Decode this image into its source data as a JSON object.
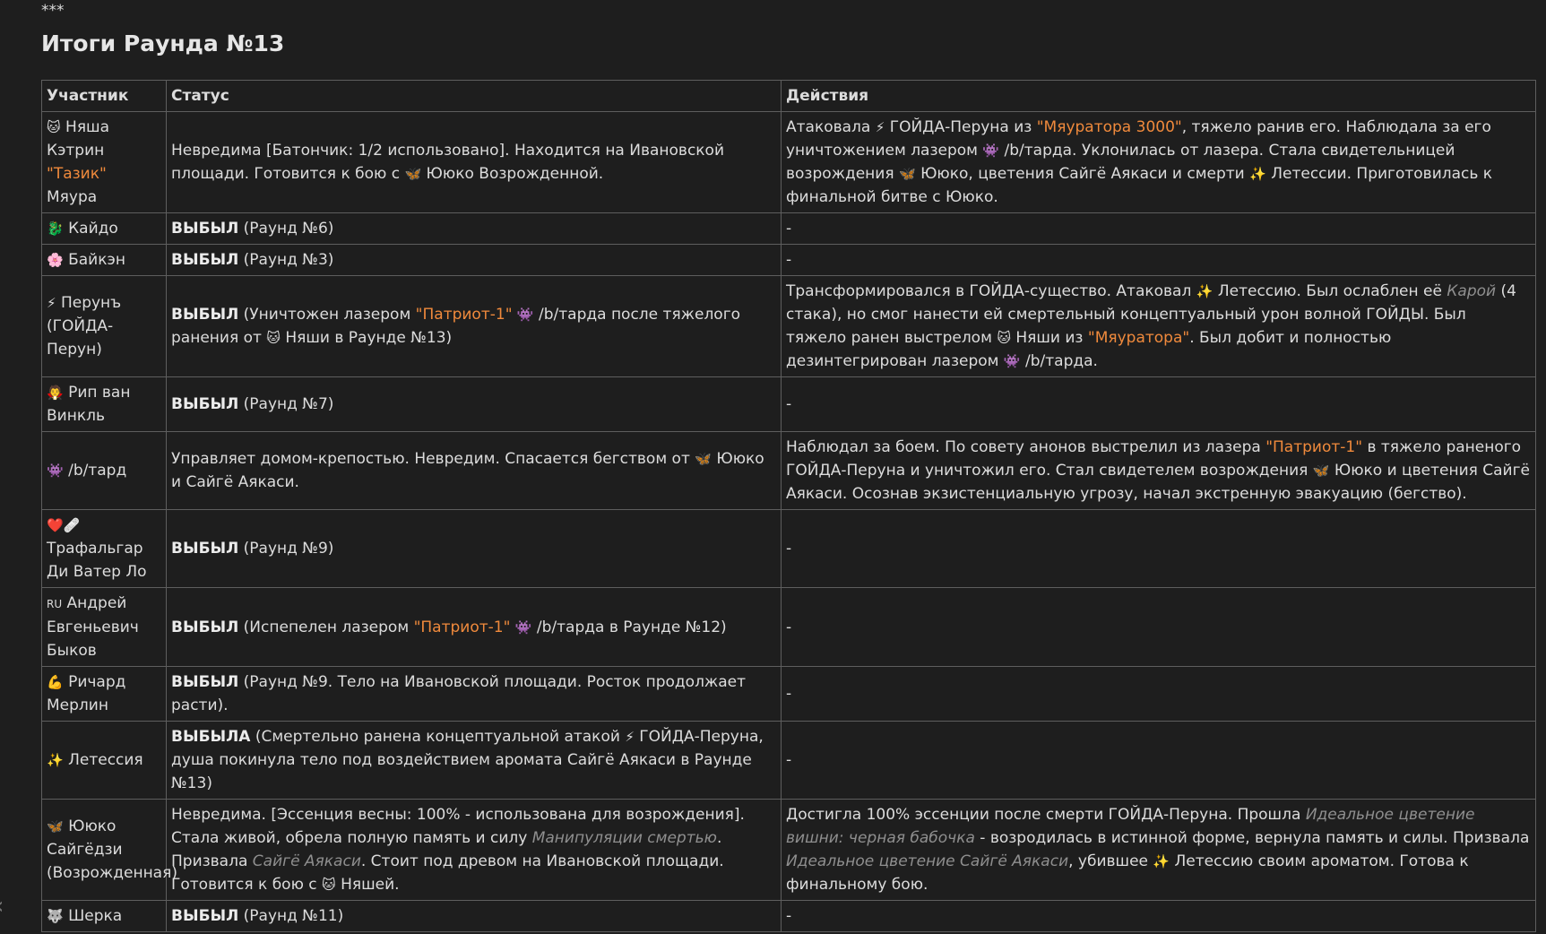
{
  "separator": "***",
  "title": "Итоги Раунда №13",
  "headers": {
    "participant": "Участник",
    "status": "Статус",
    "actions": "Действия"
  },
  "rows": [
    {
      "name": [
        "🐱",
        " Няша Кэтрин ",
        "\"Тазик\"",
        " Мяура"
      ],
      "status": [
        "Невредима [Батончик: 1/2 использовано]. Находится на Ивановской площади. Готовится к бою с ",
        "🦋",
        " Ююко Возрожденной."
      ],
      "actions": [
        "Атаковала ",
        "⚡",
        " ГОЙДА-Перуна из ",
        "\"Мяуратора 3000\"",
        ", тяжело ранив его. Наблюдала за его уничтожением лазером ",
        "👾",
        " /b/тарда. Уклонилась от лазера. Стала свидетельницей возрождения ",
        "🦋",
        " Ююко, цветения Сайгё Аякаси и смерти ",
        "✨",
        " Летессии. Приготовилась к финальной битве с Ююко."
      ]
    },
    {
      "name": [
        "🐉",
        " Кайдо"
      ],
      "status": [
        "ВЫБЫЛ",
        " (Раунд №6)"
      ],
      "actions": [
        "-"
      ]
    },
    {
      "name": [
        "🌸",
        " Байкэн"
      ],
      "status": [
        "ВЫБЫЛ",
        " (Раунд №3)"
      ],
      "actions": [
        "-"
      ]
    },
    {
      "name": [
        "⚡",
        " Перунъ (ГОЙДА-Перун)"
      ],
      "status": [
        "ВЫБЫЛ",
        " (Уничтожен лазером ",
        "\"Патриот-1\"",
        " ",
        "👾",
        " /b/тарда после тяжелого ранения от ",
        "🐱",
        " Няши в Раунде №13)"
      ],
      "actions": [
        "Трансформировался в ГОЙДА-существо. Атаковал ",
        "✨",
        " Летессию. Был ослаблен её ",
        "Карой",
        " (4 стака), но смог нанести ей смертельный концептуальный урон волной ГОЙДЫ. Был тяжело ранен выстрелом ",
        "🐱",
        " Няши из ",
        "\"Мяуратора\"",
        ". Был добит и полностью дезинтегрирован лазером ",
        "👾",
        " /b/тарда."
      ]
    },
    {
      "name": [
        "🧛",
        " Рип ван Винкль"
      ],
      "status": [
        "ВЫБЫЛ",
        " (Раунд №7)"
      ],
      "actions": [
        "-"
      ]
    },
    {
      "name": [
        "👾",
        " /b/тард"
      ],
      "status": [
        "Управляет домом-крепостью. Невредим. Спасается бегством от ",
        "🦋",
        " Ююко и Сайгё Аякаси."
      ],
      "actions": [
        "Наблюдал за боем. По совету анонов выстрелил из лазера ",
        "\"Патриот-1\"",
        " в тяжело раненого ГОЙДА-Перуна и уничтожил его. Стал свидетелем возрождения ",
        "🦋",
        " Ююко и цветения Сайгё Аякаси. Осознав экзистенциальную угрозу, начал экстренную эвакуацию (бегство)."
      ]
    },
    {
      "name": [
        "❤️",
        "🩹",
        " Трафальгар Ди Ватер Ло"
      ],
      "status": [
        "ВЫБЫЛ",
        " (Раунд №9)"
      ],
      "actions": [
        "-"
      ]
    },
    {
      "name": [
        "RU",
        " Андрей Евгеньевич Быков"
      ],
      "status": [
        "ВЫБЫЛ",
        " (Испепелен лазером ",
        "\"Патриот-1\"",
        " ",
        "👾",
        " /b/тарда в Раунде №12)"
      ],
      "actions": [
        "-"
      ]
    },
    {
      "name": [
        "💪",
        " Ричард Мерлин"
      ],
      "status": [
        "ВЫБЫЛ",
        " (Раунд №9. Тело на Ивановской площади. Росток продолжает расти)."
      ],
      "actions": [
        "-"
      ]
    },
    {
      "name": [
        "✨",
        " Летессия"
      ],
      "status": [
        "ВЫБЫЛА",
        " (Смертельно ранена концептуальной атакой ",
        "⚡",
        " ГОЙДА-Перуна, душа покинула тело под воздействием аромата Сайгё Аякаси в Раунде №13)"
      ],
      "actions": [
        "-"
      ]
    },
    {
      "name": [
        "🦋",
        " Ююко Сайгёдзи (Возрожденная)"
      ],
      "status": [
        "Невредима. [Эссенция весны: 100% - использована для возрождения]. Стала живой, обрела полную память и силу ",
        "Манипуляции смертью",
        ". Призвала ",
        "Сайгё Аякаси",
        ". Стоит под древом на Ивановской площади. Готовится к бою с ",
        "🐱",
        " Няшей."
      ],
      "actions": [
        "Достигла 100% эссенции после смерти ГОЙДА-Перуна. Прошла ",
        "Идеальное цветение вишни: черная бабочка",
        " - возродилась в истинной форме, вернула память и силы. Призвала ",
        "Идеальное цветение Сайгё Аякаси",
        ", убившее ",
        "✨",
        " Летессию своим ароматом. Готова к финальному бою."
      ]
    },
    {
      "name": [
        "🐺",
        " Шерка"
      ],
      "status": [
        "ВЫБЫЛ",
        " (Раунд №11)"
      ],
      "actions": [
        "-"
      ]
    }
  ]
}
